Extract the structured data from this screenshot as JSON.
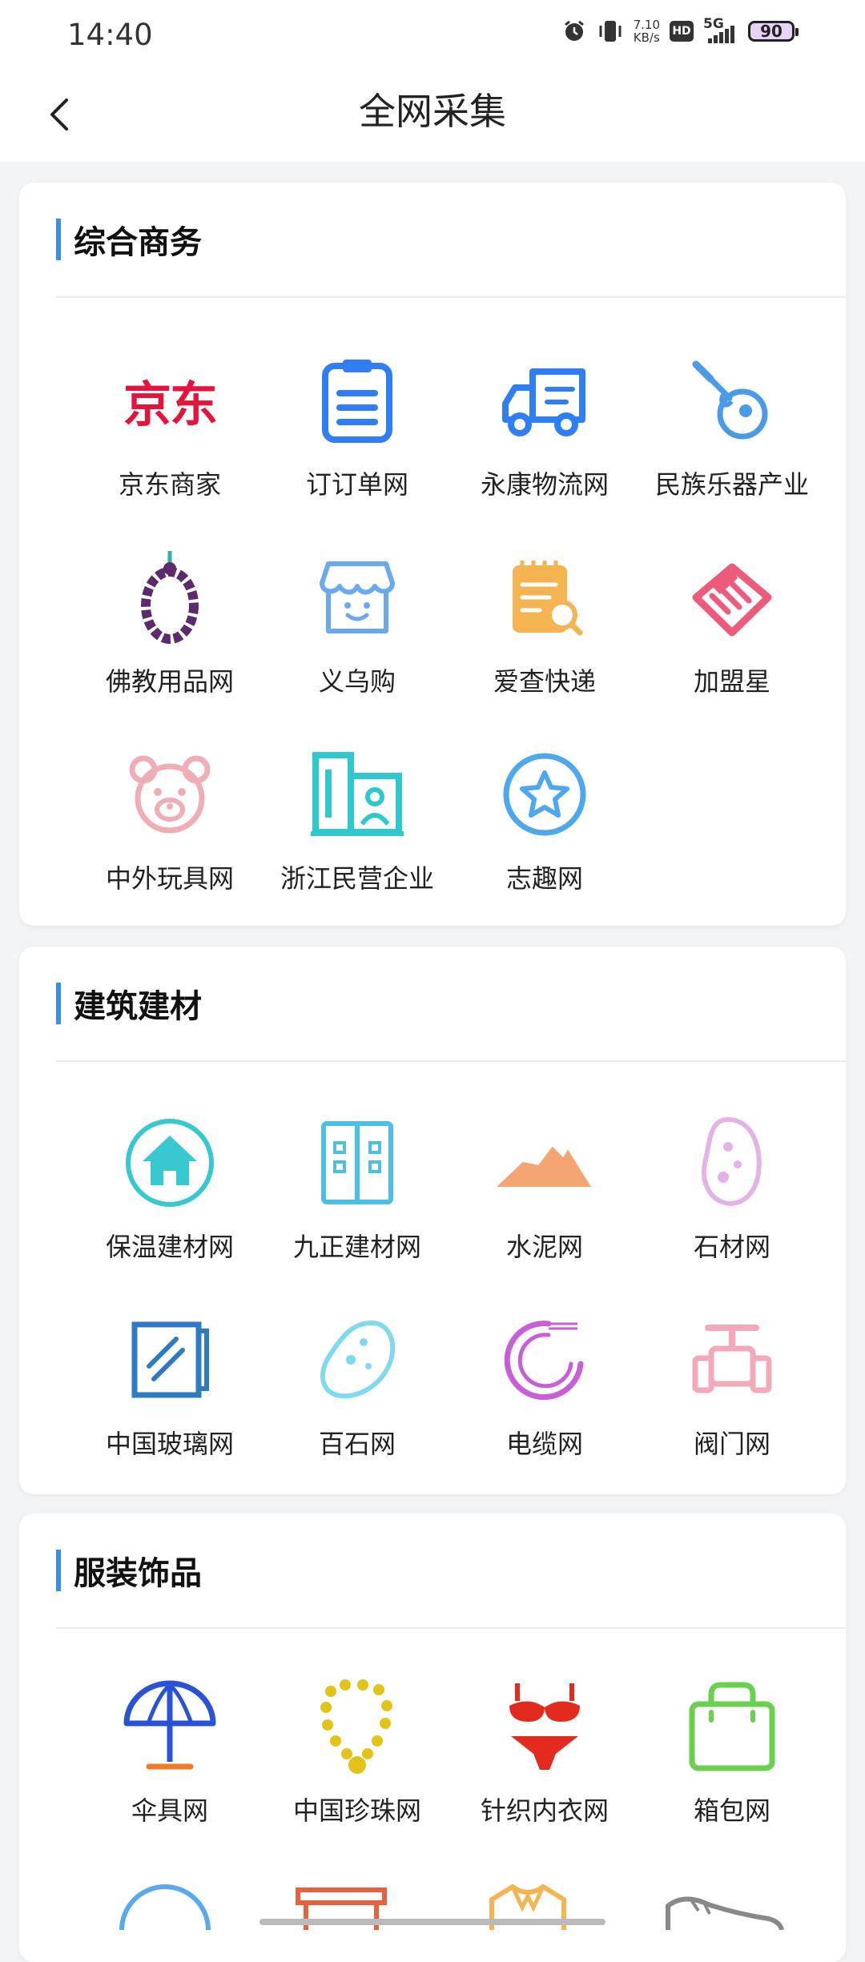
{
  "status_bar": {
    "time": "14:40",
    "net_speed_value": "7.10",
    "net_speed_unit": "KB/s",
    "hd": "HD",
    "network": "5G",
    "battery": "90"
  },
  "header": {
    "title": "全网采集",
    "back_icon": "chevron-left-icon"
  },
  "sections": [
    {
      "title": "综合商务",
      "items": [
        {
          "label": "京东商家",
          "icon": "jd-logo",
          "logo_text": "京东",
          "color": "#e4143c"
        },
        {
          "label": "订订单网",
          "icon": "clipboard-icon",
          "color": "#2f7ef6"
        },
        {
          "label": "永康物流网",
          "icon": "truck-icon",
          "color": "#2f7ef6"
        },
        {
          "label": "民族乐器产业",
          "icon": "guitar-icon",
          "color": "#4a9ae8"
        },
        {
          "label": "佛教用品网",
          "icon": "prayer-beads-icon",
          "color": "#5b2b6e"
        },
        {
          "label": "义乌购",
          "icon": "shop-icon",
          "color": "#6aa9f0"
        },
        {
          "label": "爱查快递",
          "icon": "search-document-icon",
          "color": "#f3b451"
        },
        {
          "label": "加盟星",
          "icon": "handshake-icon",
          "color": "#ec5b7a"
        },
        {
          "label": "中外玩具网",
          "icon": "bear-icon",
          "color": "#eeaeb4"
        },
        {
          "label": "浙江民营企业",
          "icon": "building-icon",
          "color": "#2fc8cf"
        },
        {
          "label": "志趣网",
          "icon": "star-badge-icon",
          "color": "#4fa7ec"
        }
      ]
    },
    {
      "title": "建筑建材",
      "items": [
        {
          "label": "保温建材网",
          "icon": "house-icon",
          "color": "#37c9cf"
        },
        {
          "label": "九正建材网",
          "icon": "cabinet-icon",
          "color": "#4ac0e6"
        },
        {
          "label": "水泥网",
          "icon": "mountain-icon",
          "color": "#f5a572"
        },
        {
          "label": "石材网",
          "icon": "stone-icon",
          "color": "#e3b3e8"
        },
        {
          "label": "中国玻璃网",
          "icon": "glass-pane-icon",
          "color": "#2f7bc1"
        },
        {
          "label": "百石网",
          "icon": "rock-icon",
          "color": "#7fd9ef"
        },
        {
          "label": "电缆网",
          "icon": "cable-icon",
          "color": "#c85fd6"
        },
        {
          "label": "阀门网",
          "icon": "valve-icon",
          "color": "#f4a9b8"
        }
      ]
    },
    {
      "title": "服装饰品",
      "items": [
        {
          "label": "伞具网",
          "icon": "umbrella-icon",
          "color": "#2a52d6"
        },
        {
          "label": "中国珍珠网",
          "icon": "pearl-necklace-icon",
          "color": "#e3c21a"
        },
        {
          "label": "针织内衣网",
          "icon": "lingerie-icon",
          "color": "#e32a1e"
        },
        {
          "label": "箱包网",
          "icon": "bag-icon",
          "color": "#6ad04f"
        }
      ]
    }
  ]
}
